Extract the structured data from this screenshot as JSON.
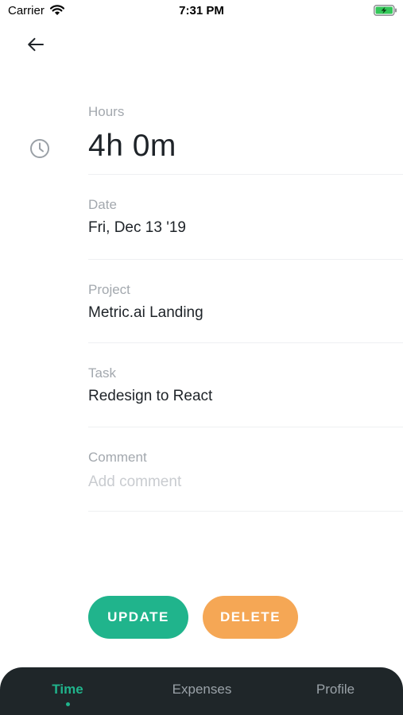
{
  "status_bar": {
    "carrier": "Carrier",
    "time": "7:31 PM",
    "icons": [
      "wifi-icon",
      "battery-charging-icon"
    ]
  },
  "header": {
    "back_icon": "arrow-left-icon"
  },
  "form": {
    "hours": {
      "label": "Hours",
      "value": "4h 0m",
      "icon": "clock-icon"
    },
    "date": {
      "label": "Date",
      "value": "Fri, Dec 13 '19"
    },
    "project": {
      "label": "Project",
      "value": "Metric.ai Landing"
    },
    "task": {
      "label": "Task",
      "value": "Redesign to React"
    },
    "comment": {
      "label": "Comment",
      "value": "",
      "placeholder": "Add comment"
    }
  },
  "actions": {
    "update_label": "UPDATE",
    "delete_label": "DELETE"
  },
  "tab_bar": {
    "tabs": [
      {
        "label": "Time",
        "active": true
      },
      {
        "label": "Expenses",
        "active": false
      },
      {
        "label": "Profile",
        "active": false
      }
    ]
  },
  "colors": {
    "accent": "#20b48c",
    "danger": "#f5a755",
    "tab_bar_bg": "#1f2629",
    "label": "#a3a8ae",
    "text": "#1e2328"
  }
}
